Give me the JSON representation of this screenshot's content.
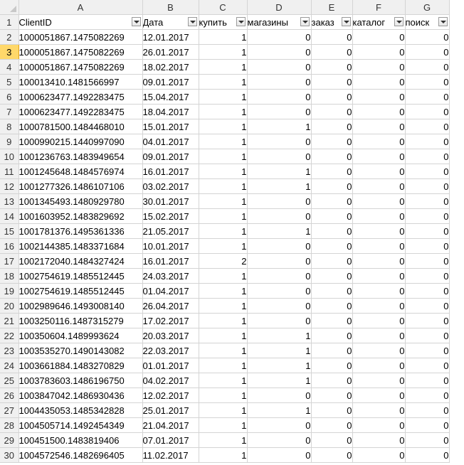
{
  "columns": [
    "A",
    "B",
    "C",
    "D",
    "E",
    "F",
    "G"
  ],
  "header_row_number": "1",
  "headers": [
    "ClientID",
    "Дата",
    "купить",
    "магазины",
    "заказ",
    "каталог",
    "поиск"
  ],
  "selected_row": "3",
  "rows": [
    {
      "n": "2",
      "id": "1000051867.1475082269",
      "date": "12.01.2017",
      "v": [
        "1",
        "0",
        "0",
        "0",
        "0"
      ]
    },
    {
      "n": "3",
      "id": "1000051867.1475082269",
      "date": "26.01.2017",
      "v": [
        "1",
        "0",
        "0",
        "0",
        "0"
      ]
    },
    {
      "n": "4",
      "id": "1000051867.1475082269",
      "date": "18.02.2017",
      "v": [
        "1",
        "0",
        "0",
        "0",
        "0"
      ]
    },
    {
      "n": "5",
      "id": "100013410.1481566997",
      "date": "09.01.2017",
      "v": [
        "1",
        "0",
        "0",
        "0",
        "0"
      ]
    },
    {
      "n": "6",
      "id": "1000623477.1492283475",
      "date": "15.04.2017",
      "v": [
        "1",
        "0",
        "0",
        "0",
        "0"
      ]
    },
    {
      "n": "7",
      "id": "1000623477.1492283475",
      "date": "18.04.2017",
      "v": [
        "1",
        "0",
        "0",
        "0",
        "0"
      ]
    },
    {
      "n": "8",
      "id": "1000781500.1484468010",
      "date": "15.01.2017",
      "v": [
        "1",
        "1",
        "0",
        "0",
        "0"
      ]
    },
    {
      "n": "9",
      "id": "1000990215.1440997090",
      "date": "04.01.2017",
      "v": [
        "1",
        "0",
        "0",
        "0",
        "0"
      ]
    },
    {
      "n": "10",
      "id": "1001236763.1483949654",
      "date": "09.01.2017",
      "v": [
        "1",
        "0",
        "0",
        "0",
        "0"
      ]
    },
    {
      "n": "11",
      "id": "1001245648.1484576974",
      "date": "16.01.2017",
      "v": [
        "1",
        "1",
        "0",
        "0",
        "0"
      ]
    },
    {
      "n": "12",
      "id": "1001277326.1486107106",
      "date": "03.02.2017",
      "v": [
        "1",
        "1",
        "0",
        "0",
        "0"
      ]
    },
    {
      "n": "13",
      "id": "1001345493.1480929780",
      "date": "30.01.2017",
      "v": [
        "1",
        "0",
        "0",
        "0",
        "0"
      ]
    },
    {
      "n": "14",
      "id": "1001603952.1483829692",
      "date": "15.02.2017",
      "v": [
        "1",
        "0",
        "0",
        "0",
        "0"
      ]
    },
    {
      "n": "15",
      "id": "1001781376.1495361336",
      "date": "21.05.2017",
      "v": [
        "1",
        "1",
        "0",
        "0",
        "0"
      ]
    },
    {
      "n": "16",
      "id": "1002144385.1483371684",
      "date": "10.01.2017",
      "v": [
        "1",
        "0",
        "0",
        "0",
        "0"
      ]
    },
    {
      "n": "17",
      "id": "1002172040.1484327424",
      "date": "16.01.2017",
      "v": [
        "2",
        "0",
        "0",
        "0",
        "0"
      ]
    },
    {
      "n": "18",
      "id": "1002754619.1485512445",
      "date": "24.03.2017",
      "v": [
        "1",
        "0",
        "0",
        "0",
        "0"
      ]
    },
    {
      "n": "19",
      "id": "1002754619.1485512445",
      "date": "01.04.2017",
      "v": [
        "1",
        "0",
        "0",
        "0",
        "0"
      ]
    },
    {
      "n": "20",
      "id": "1002989646.1493008140",
      "date": "26.04.2017",
      "v": [
        "1",
        "0",
        "0",
        "0",
        "0"
      ]
    },
    {
      "n": "21",
      "id": "1003250116.1487315279",
      "date": "17.02.2017",
      "v": [
        "1",
        "0",
        "0",
        "0",
        "0"
      ]
    },
    {
      "n": "22",
      "id": "100350604.1489993624",
      "date": "20.03.2017",
      "v": [
        "1",
        "1",
        "0",
        "0",
        "0"
      ]
    },
    {
      "n": "23",
      "id": "1003535270.1490143082",
      "date": "22.03.2017",
      "v": [
        "1",
        "1",
        "0",
        "0",
        "0"
      ]
    },
    {
      "n": "24",
      "id": "1003661884.1483270829",
      "date": "01.01.2017",
      "v": [
        "1",
        "1",
        "0",
        "0",
        "0"
      ]
    },
    {
      "n": "25",
      "id": "1003783603.1486196750",
      "date": "04.02.2017",
      "v": [
        "1",
        "1",
        "0",
        "0",
        "0"
      ]
    },
    {
      "n": "26",
      "id": "1003847042.1486930436",
      "date": "12.02.2017",
      "v": [
        "1",
        "0",
        "0",
        "0",
        "0"
      ]
    },
    {
      "n": "27",
      "id": "1004435053.1485342828",
      "date": "25.01.2017",
      "v": [
        "1",
        "1",
        "0",
        "0",
        "0"
      ]
    },
    {
      "n": "28",
      "id": "1004505714.1492454349",
      "date": "21.04.2017",
      "v": [
        "1",
        "0",
        "0",
        "0",
        "0"
      ]
    },
    {
      "n": "29",
      "id": "100451500.1483819406",
      "date": "07.01.2017",
      "v": [
        "1",
        "0",
        "0",
        "0",
        "0"
      ]
    },
    {
      "n": "30",
      "id": "1004572546.1482696405",
      "date": "11.02.2017",
      "v": [
        "1",
        "0",
        "0",
        "0",
        "0"
      ]
    }
  ]
}
